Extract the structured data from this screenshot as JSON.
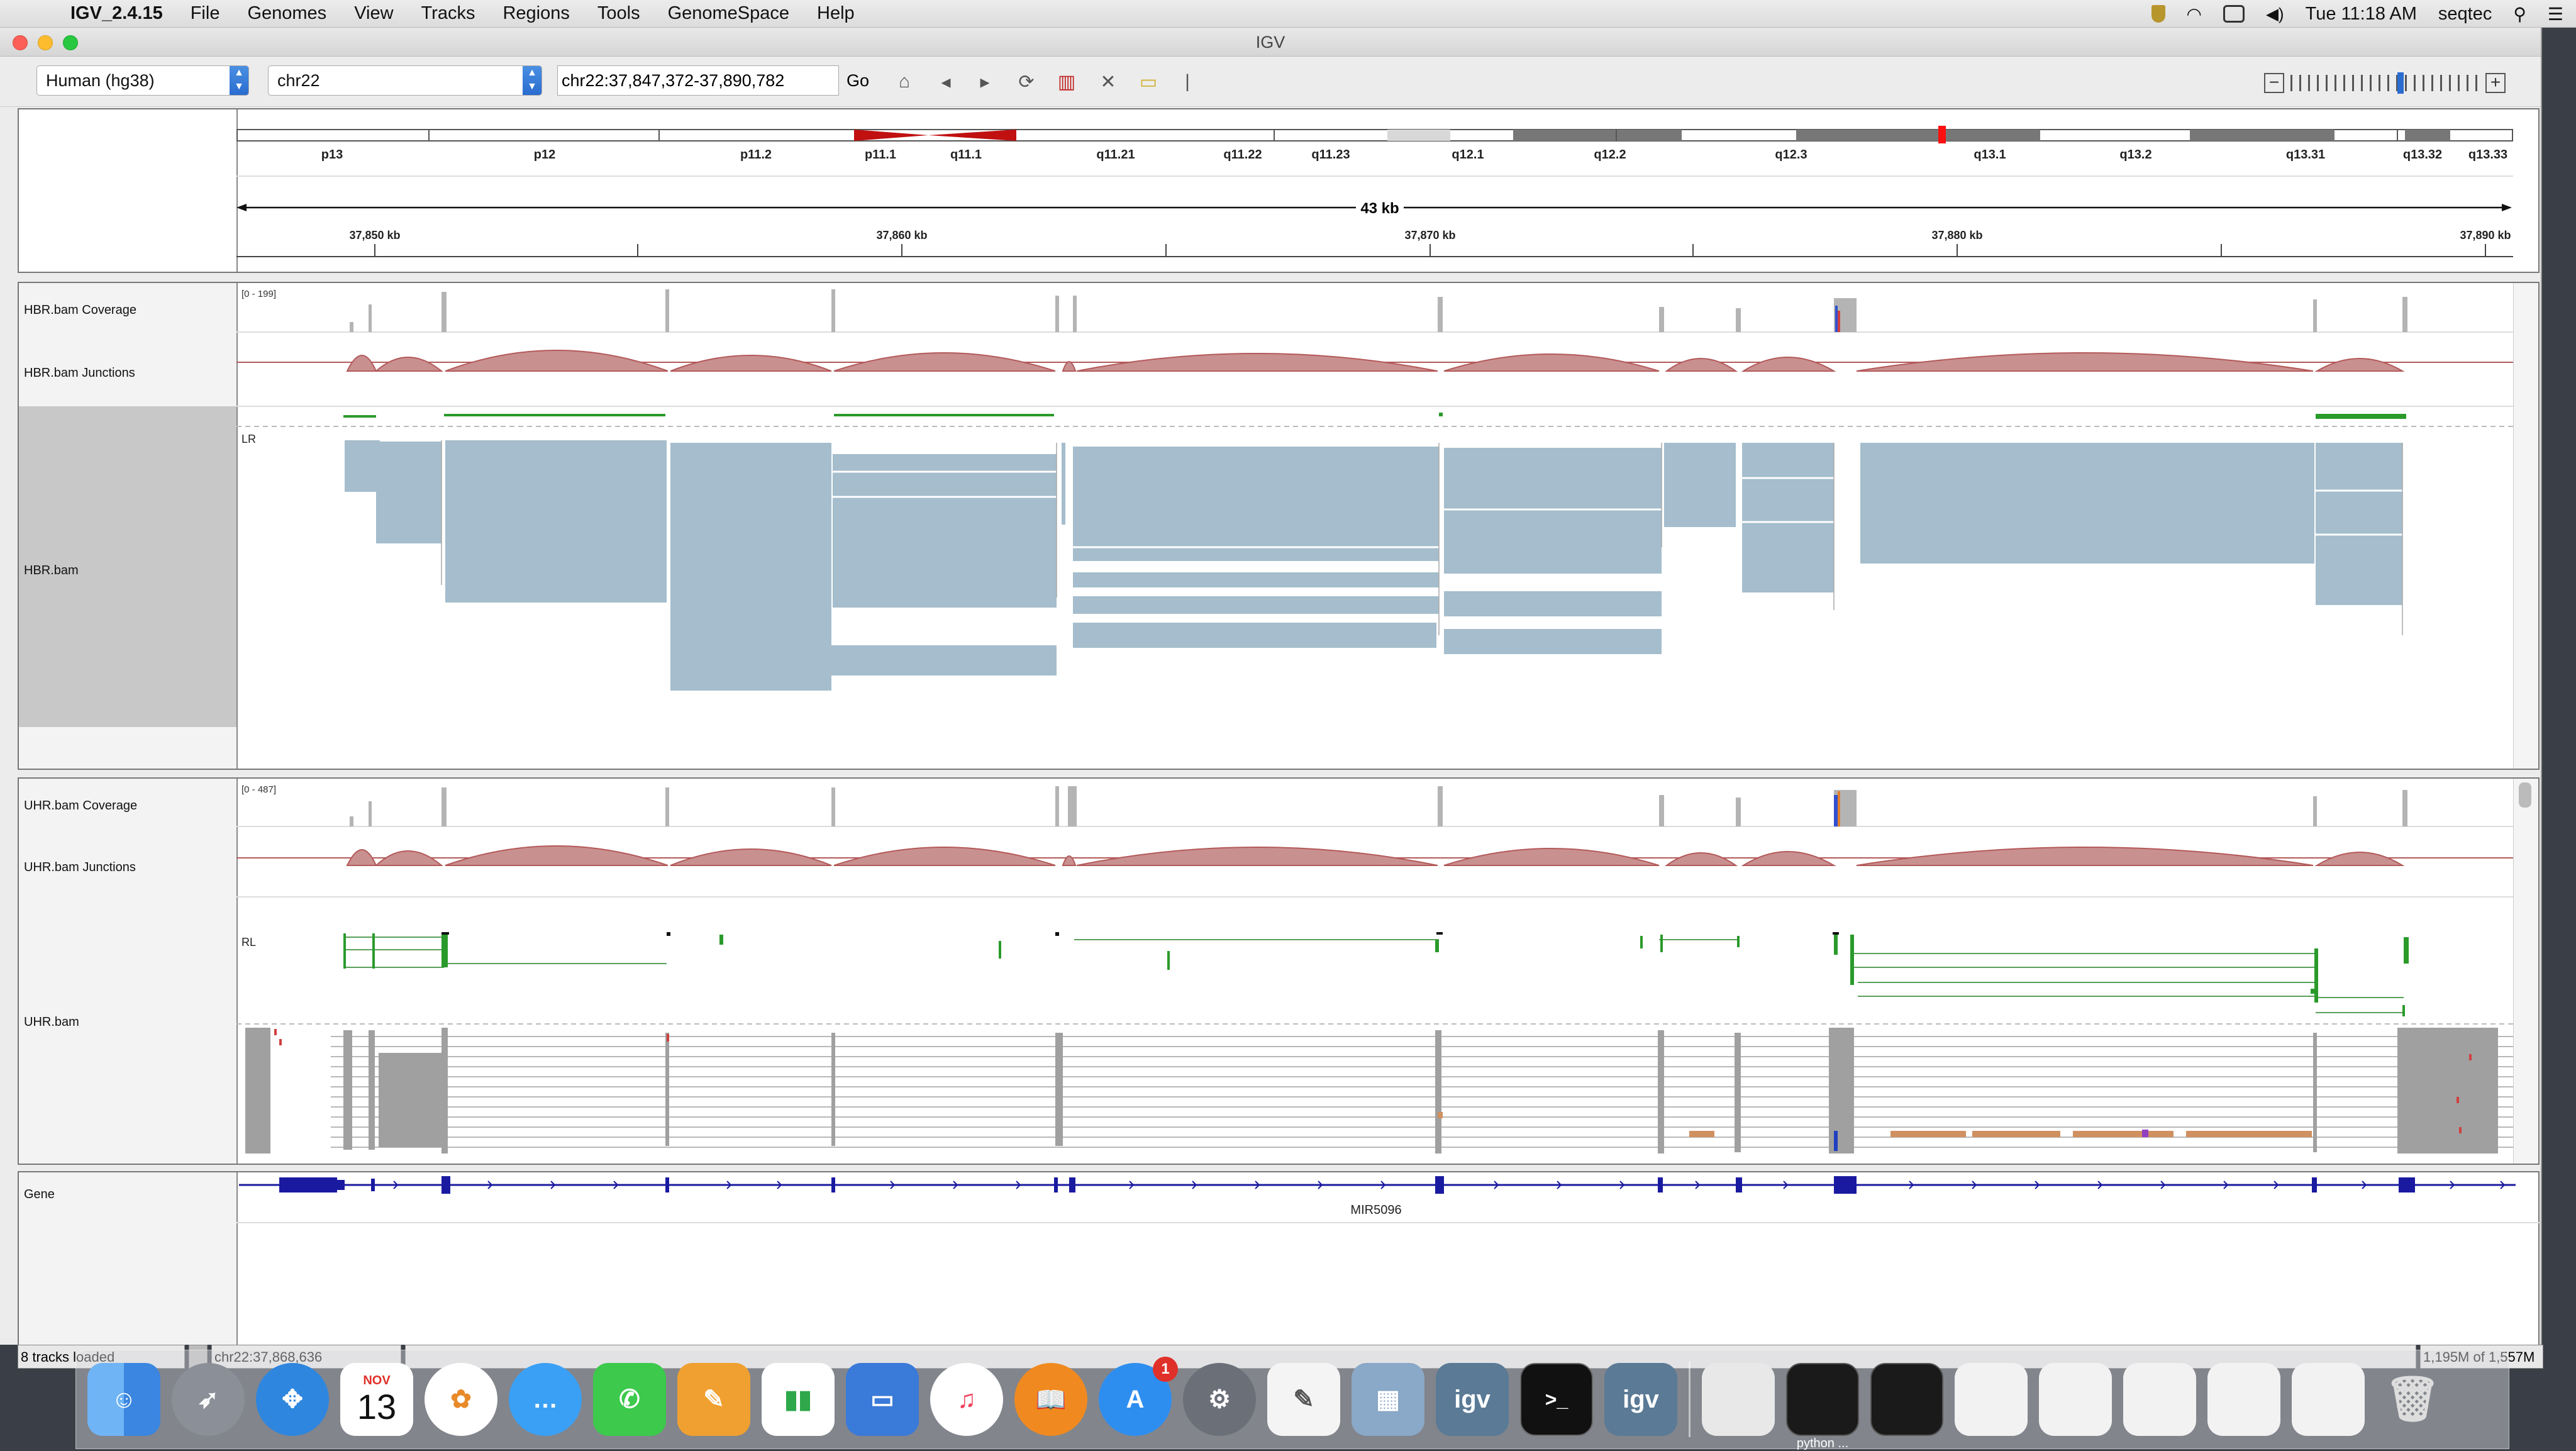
{
  "menubar": {
    "app_name": "IGV_2.4.15",
    "items": [
      "File",
      "Genomes",
      "View",
      "Tracks",
      "Regions",
      "Tools",
      "GenomeSpace",
      "Help"
    ],
    "clock": "Tue 11:18 AM",
    "user": "seqtec"
  },
  "window": {
    "title": "IGV"
  },
  "toolbar": {
    "genome": "Human (hg38)",
    "chromosome": "chr22",
    "locus": "chr22:37,847,372-37,890,782",
    "go_label": "Go",
    "zoom_minus": "−",
    "zoom_plus": "+"
  },
  "ideogram": {
    "bands": [
      "p13",
      "p12",
      "p11.2",
      "p11.1",
      "q11.1",
      "q11.21",
      "q11.22",
      "q11.23",
      "q12.1",
      "q12.2",
      "q12.3",
      "q13.1",
      "q13.2",
      "q13.31",
      "q13.32",
      "q13.33"
    ],
    "span_label": "43 kb",
    "ruler_ticks": [
      "37,850 kb",
      "37,860 kb",
      "37,870 kb",
      "37,880 kb",
      "37,890 kb"
    ]
  },
  "tracks": {
    "hbr_coverage": {
      "name": "HBR.bam Coverage",
      "range": "[0 - 199]"
    },
    "hbr_junctions": {
      "name": "HBR.bam Junctions"
    },
    "hbr_bam": {
      "name": "HBR.bam",
      "strand_label": "LR"
    },
    "uhr_coverage": {
      "name": "UHR.bam Coverage",
      "range": "[0 - 487]"
    },
    "uhr_junctions": {
      "name": "UHR.bam Junctions"
    },
    "uhr_bam": {
      "name": "UHR.bam",
      "strand_label": "RL"
    },
    "gene": {
      "name": "Gene",
      "feature_label": "MIR5096"
    }
  },
  "status": {
    "tracks_loaded": "8 tracks loaded",
    "position": "chr22:37,868,636",
    "memory": "1,195M of 1,557M"
  },
  "dock": {
    "apps": [
      "finder-icon",
      "launchpad-icon",
      "safari-icon",
      "calendar-icon",
      "photos-icon",
      "messages-icon",
      "facetime-icon",
      "pages-icon",
      "numbers-icon",
      "keynote-icon",
      "itunes-icon",
      "ibooks-icon",
      "app-store-icon",
      "system-preferences-icon",
      "textedit-icon",
      "preview-icon",
      "igv-icon",
      "terminal-icon",
      "igv-icon-2"
    ],
    "calendar_month": "NOV",
    "calendar_day": "13",
    "app_store_badge": "1",
    "igv_label": "igv",
    "terminal_label": ">_",
    "window_label": "python ..."
  },
  "colors": {
    "coverage": "#b4b4b4",
    "junction": "#b45a5a",
    "read": "#a5bdcc",
    "gene": "#1a1aa0",
    "feature_green": "#2a9a2a"
  }
}
